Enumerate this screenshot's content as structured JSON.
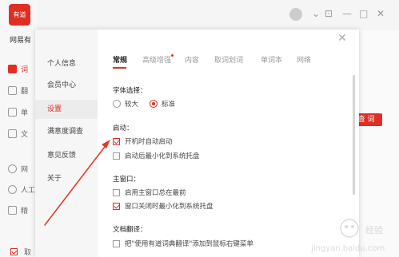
{
  "app": {
    "logo_text": "有道",
    "name": "网易有",
    "sidebar": [
      {
        "label": "词",
        "icon": "dictionary-icon",
        "active": true
      },
      {
        "label": "翻",
        "icon": "translate-icon",
        "active": false
      },
      {
        "label": "单",
        "icon": "wordbook-icon",
        "active": false
      },
      {
        "label": "文",
        "icon": "document-icon",
        "active": false
      },
      {
        "label": "网",
        "icon": "web-icon",
        "active": false
      },
      {
        "label": "人工",
        "icon": "human-icon",
        "active": false
      },
      {
        "label": "精",
        "icon": "featured-icon",
        "active": false
      }
    ],
    "search_button": "查 词",
    "bottom_label": "取",
    "window_controls": [
      "⊡",
      "—",
      "□",
      "✕"
    ]
  },
  "dialog": {
    "nav": [
      {
        "label": "个人信息",
        "active": false
      },
      {
        "label": "会员中心",
        "active": false
      },
      {
        "label": "设置",
        "active": true
      },
      {
        "label": "满意度调查",
        "active": false
      },
      {
        "label": "意见反馈",
        "active": false
      },
      {
        "label": "关于",
        "active": false
      }
    ],
    "tabs": [
      {
        "label": "常规",
        "active": true
      },
      {
        "label": "高级增强",
        "active": false,
        "badge": true
      },
      {
        "label": "内容",
        "active": false
      },
      {
        "label": "取词划词",
        "active": false
      },
      {
        "label": "单词本",
        "active": false
      },
      {
        "label": "网络",
        "active": false
      }
    ],
    "font_section": {
      "title": "字体选择：",
      "options": [
        {
          "label": "较大",
          "checked": false
        },
        {
          "label": "标准",
          "checked": true
        }
      ]
    },
    "startup_section": {
      "title": "启动：",
      "options": [
        {
          "label": "开机时自动启动",
          "checked": true
        },
        {
          "label": "启动后最小化到系统托盘",
          "checked": false
        }
      ]
    },
    "main_window_section": {
      "title": "主窗口：",
      "options": [
        {
          "label": "启用主窗口总在最前",
          "checked": false
        },
        {
          "label": "窗口关闭时最小化到系统托盘",
          "checked": true
        }
      ]
    },
    "doc_translate_section": {
      "title": "文档翻译：",
      "options": [
        {
          "label": "把\"使用有道词典翻译\"添加到鼠标右键菜单",
          "checked": false
        }
      ]
    }
  },
  "colors": {
    "accent": "#e02e24",
    "arrow": "#e23b2b"
  }
}
